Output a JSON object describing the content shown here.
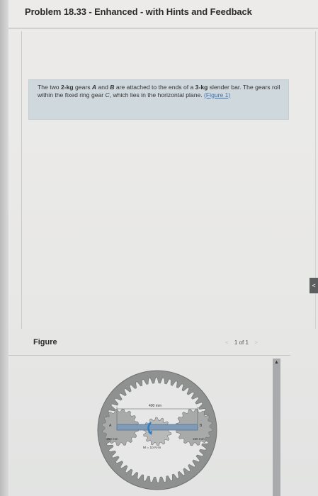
{
  "title": "Problem 18.33 - Enhanced - with Hints and Feedback",
  "problem": {
    "sentence1_prefix": "The two ",
    "mass1": "2-kg",
    "sentence1_mid": " gears ",
    "gear_a": "A",
    "and": " and ",
    "gear_b": "B",
    "sentence1_mid2": " are attached to the ends of a ",
    "mass2": "3-kg",
    "sentence1_suffix": " slender bar. The gears roll within the fixed ring gear ",
    "gear_c": "C",
    "sentence2_suffix": ", which lies in the horizontal plane. ",
    "figure_link": "(Figure 1)"
  },
  "figure": {
    "label": "Figure",
    "pager": {
      "prev": "<",
      "count": "1 of 1",
      "next": ">"
    },
    "annotations": {
      "length_top": "400 mm",
      "radius_left": "150 mm",
      "radius_right": "150 mm",
      "moment": "M = 10 N·m",
      "point_a": "A",
      "point_b": "B"
    }
  },
  "side_tab": "<",
  "colors": {
    "problem_box": "#cfd8dc",
    "link": "#3a6fb0",
    "ring_gear": "#8f9190",
    "small_gears": "#a8aaa9",
    "bar": "#6f8fb0",
    "moment_arrow": "#2f7fc4"
  }
}
